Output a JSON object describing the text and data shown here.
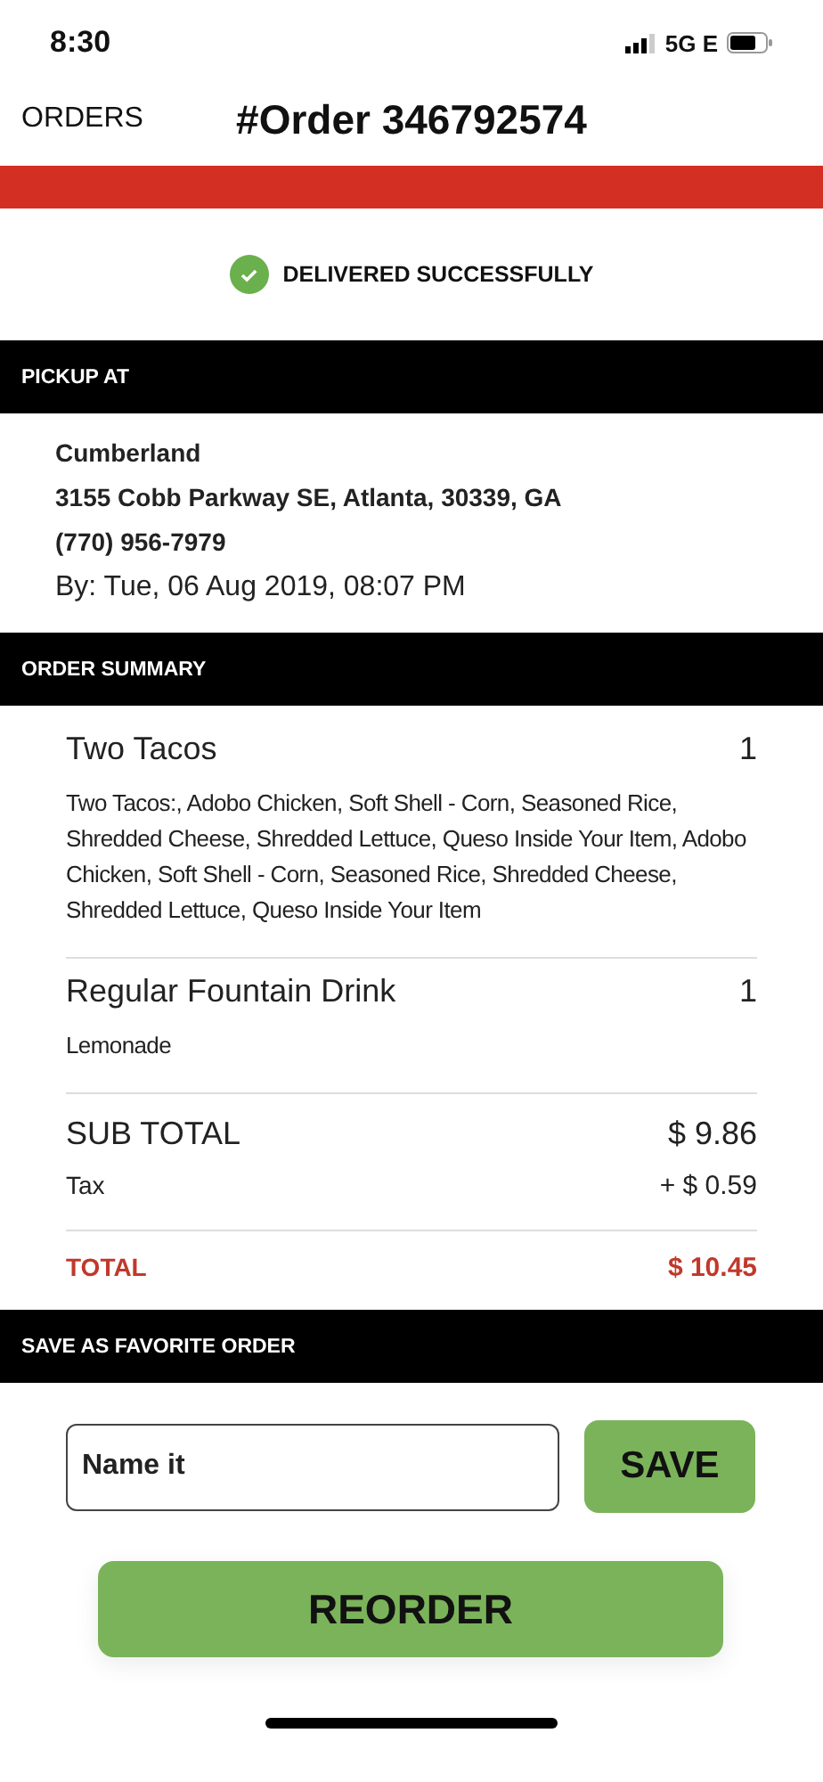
{
  "status_bar": {
    "time": "8:30",
    "network": "5G E"
  },
  "nav": {
    "back": "ORDERS",
    "title": "#Order 346792574"
  },
  "status": {
    "text": "DELIVERED SUCCESSFULLY",
    "delivered": true
  },
  "pickup": {
    "header": "PICKUP AT",
    "store": "Cumberland",
    "address": "3155 Cobb Parkway SE, Atlanta, 30339, GA",
    "phone": "(770) 956-7979",
    "time": "By: Tue, 06 Aug 2019, 08:07 PM"
  },
  "summary": {
    "header": "ORDER SUMMARY",
    "items": [
      {
        "name": "Two Tacos",
        "qty": "1",
        "details": "Two Tacos:, Adobo Chicken, Soft Shell - Corn, Seasoned Rice, Shredded Cheese, Shredded Lettuce, Queso Inside Your Item, Adobo Chicken, Soft Shell - Corn, Seasoned Rice, Shredded Cheese, Shredded Lettuce, Queso Inside Your Item"
      },
      {
        "name": "Regular Fountain Drink",
        "qty": "1",
        "details": "Lemonade"
      }
    ],
    "subtotal_label": "SUB TOTAL",
    "subtotal": "$ 9.86",
    "tax_label": "Tax",
    "tax": "+ $ 0.59",
    "total_label": "TOTAL",
    "total": "$ 10.45"
  },
  "favorite": {
    "header": "SAVE AS FAVORITE ORDER",
    "placeholder": "Name it",
    "save": "SAVE"
  },
  "reorder": "REORDER"
}
